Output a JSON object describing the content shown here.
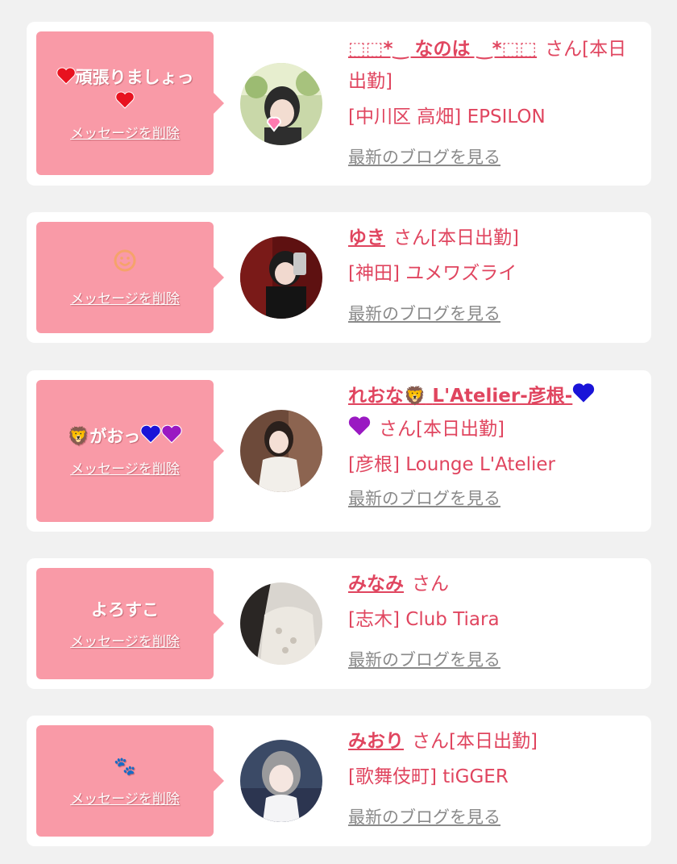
{
  "colors": {
    "page_bg": "#f1f1f1",
    "card_bg": "#ffffff",
    "bubble_bg": "#f99aa7",
    "accent": "#e0455f",
    "link_gray": "#8a8a8a"
  },
  "delete_label": "メッセージを削除",
  "blog_label": "最新のブログを見る",
  "cards": [
    {
      "message": "頑張りましょっ",
      "name": "⬚⬚*‿ なのは ‿*⬚⬚",
      "suffix": "さん[本日出勤]",
      "shop": "[中川区 高畑] EPSILON"
    },
    {
      "message": "",
      "name": "ゆき",
      "suffix": "さん[本日出勤]",
      "shop": "[神田] ユメワズライ"
    },
    {
      "message": "がおっ",
      "name": "れおな",
      "name_tail": "L'Atelier-彦根-",
      "suffix": "さん[本日出勤]",
      "shop": "[彦根] Lounge L'Atelier"
    },
    {
      "message": "よろすこ",
      "name": "みなみ",
      "suffix": "さん",
      "shop": "[志木] Club Tiara"
    },
    {
      "message": "",
      "name": "みおり",
      "suffix": "さん[本日出勤]",
      "shop": "[歌舞伎町] tiGGER"
    }
  ]
}
